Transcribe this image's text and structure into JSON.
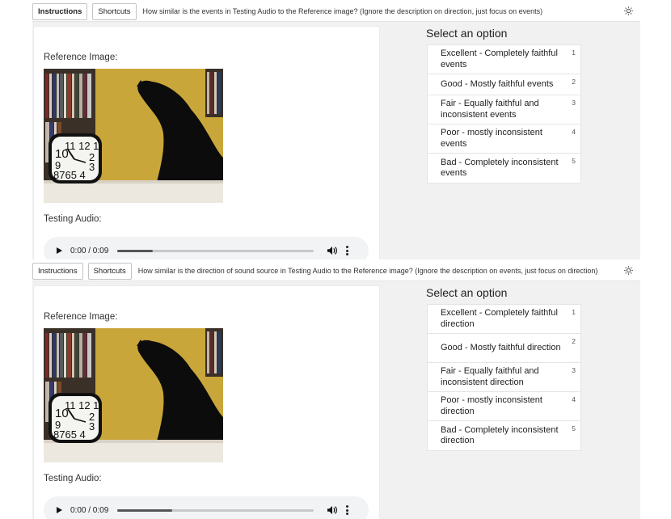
{
  "panels": [
    {
      "toolbar": {
        "instructions_label": "Instructions",
        "shortcuts_label": "Shortcuts",
        "question": "How similar is the events in Testing Audio to the Reference image? (Ignore the description on direction, just focus on events)"
      },
      "card": {
        "reference_label": "Reference Image:",
        "testing_label": "Testing Audio:",
        "audio": {
          "time": "0:00 / 0:09",
          "progress": 0.18
        }
      },
      "select_title": "Select an option",
      "options": [
        {
          "label": "Excellent - Completely faithful events",
          "key": "1"
        },
        {
          "label": "Good - Mostly faithful events",
          "key": "2"
        },
        {
          "label": "Fair - Equally faithful and inconsistent events",
          "key": "3"
        },
        {
          "label": "Poor - mostly inconsistent events",
          "key": "4"
        },
        {
          "label": "Bad - Completely inconsistent events",
          "key": "5"
        }
      ]
    },
    {
      "toolbar": {
        "instructions_label": "Instructions",
        "shortcuts_label": "Shortcuts",
        "question": "How similar is the direction of sound source in Testing Audio to the Reference image? (Ignore the description on events, just focus on direction)"
      },
      "card": {
        "reference_label": "Reference Image:",
        "testing_label": "Testing Audio:",
        "audio": {
          "time": "0:00 / 0:09",
          "progress": 0.28
        }
      },
      "select_title": "Select an option",
      "options": [
        {
          "label": "Excellent - Completely faithful direction",
          "key": "1"
        },
        {
          "label": "Good - Mostly faithful direction",
          "key": "2"
        },
        {
          "label": "Fair - Equally faithful and inconsistent direction",
          "key": "3"
        },
        {
          "label": "Poor - mostly inconsistent direction",
          "key": "4"
        },
        {
          "label": "Bad - Completely inconsistent direction",
          "key": "5"
        }
      ]
    }
  ]
}
